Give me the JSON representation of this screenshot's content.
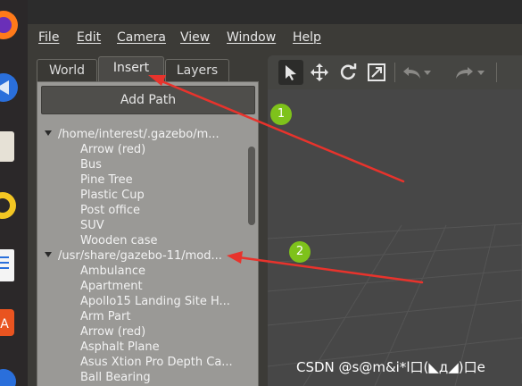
{
  "menu": [
    {
      "label": "File"
    },
    {
      "label": "Edit"
    },
    {
      "label": "Camera"
    },
    {
      "label": "View"
    },
    {
      "label": "Window"
    },
    {
      "label": "Help"
    }
  ],
  "tabs": [
    {
      "label": "World"
    },
    {
      "label": "Insert",
      "active": true
    },
    {
      "label": "Layers"
    }
  ],
  "add_path_label": "Add Path",
  "tree": {
    "paths": [
      {
        "path": "/home/interest/.gazebo/m...",
        "models": [
          "Arrow (red)",
          "Bus",
          "Pine Tree",
          "Plastic Cup",
          "Post office",
          "SUV",
          "Wooden case"
        ]
      },
      {
        "path": "/usr/share/gazebo-11/mod...",
        "models": [
          "Ambulance",
          "Apartment",
          "Apollo15 Landing Site H...",
          "Arm Part",
          "Arrow (red)",
          "Asphalt Plane",
          "Asus Xtion Pro Depth Ca...",
          "Ball Bearing"
        ]
      }
    ]
  },
  "toolbar_icons": [
    "select-arrow-icon",
    "translate-icon",
    "rotate-icon",
    "scale-icon",
    "undo-icon",
    "undo-dropdown-icon",
    "redo-icon",
    "redo-dropdown-icon"
  ],
  "annotations": {
    "badges": [
      "1",
      "2"
    ],
    "arrow_color": "#e8332c",
    "badge_color": "#7ec21b"
  },
  "watermark": "CSDN @s@m&i*l口(◣д◢)口e",
  "colors": {
    "panel_bg": "#9a9996",
    "menubar_bg": "#3c3b37",
    "scene_bg": "#474747"
  }
}
